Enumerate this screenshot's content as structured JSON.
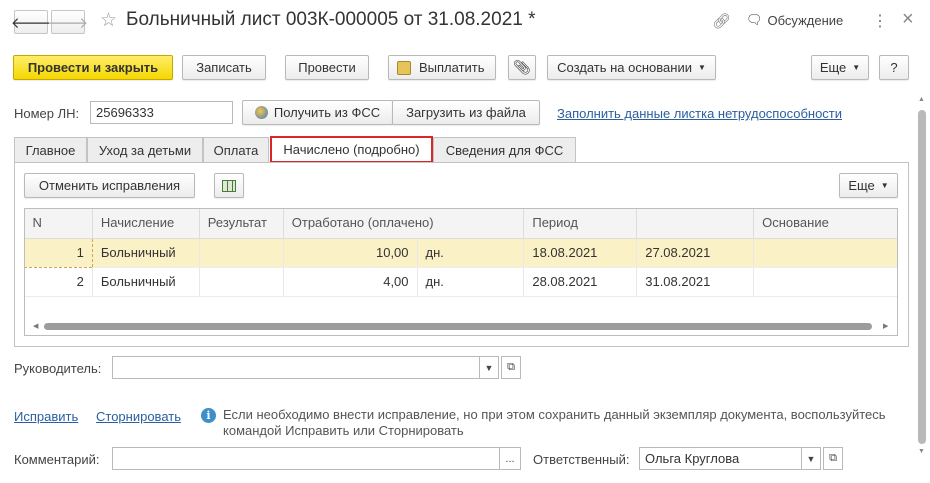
{
  "window": {
    "title": "Больничный лист 003К-000005 от 31.08.2021 *",
    "discussion_label": "Обсуждение",
    "more_dots": "⋮",
    "close": "×"
  },
  "toolbar": {
    "post_close": "Провести и закрыть",
    "write": "Записать",
    "post": "Провести",
    "pay": "Выплатить",
    "create_based": "Создать на основании",
    "more": "Еще",
    "help": "?"
  },
  "header": {
    "ln_label": "Номер ЛН:",
    "ln_value": "25696333",
    "get_fss": "Получить из ФСС",
    "load_file": "Загрузить из файла",
    "fill_link": "Заполнить данные листка нетрудоспособности"
  },
  "tabs": [
    {
      "label": "Главное"
    },
    {
      "label": "Уход за детьми"
    },
    {
      "label": "Оплата"
    },
    {
      "label": "Начислено (подробно)"
    },
    {
      "label": "Сведения для ФСС"
    }
  ],
  "panel": {
    "cancel_fix": "Отменить исправления",
    "more": "Еще"
  },
  "table": {
    "columns": [
      "N",
      "Начисление",
      "Результат",
      "Отработано (оплачено)",
      "",
      "Период",
      "",
      "Основание"
    ],
    "rows": [
      {
        "n": "1",
        "accrual": "Больничный",
        "result": "",
        "worked": "10,00",
        "unit": "дн.",
        "from": "18.08.2021",
        "to": "27.08.2021",
        "basis": ""
      },
      {
        "n": "2",
        "accrual": "Больничный",
        "result": "",
        "worked": "4,00",
        "unit": "дн.",
        "from": "28.08.2021",
        "to": "31.08.2021",
        "basis": ""
      }
    ]
  },
  "footer": {
    "manager_label": "Руководитель:",
    "manager_value": "",
    "fix_link": "Исправить",
    "storno_link": "Сторнировать",
    "info_text": "Если необходимо внести исправление, но при этом сохранить данный экземпляр документа, воспользуйтесь командой Исправить или Сторнировать",
    "comment_label": "Комментарий:",
    "comment_value": "",
    "responsible_label": "Ответственный:",
    "responsible_value": "Ольга Круглова"
  },
  "colors": {
    "primary_button": "#f5d800",
    "link": "#2a5fa0",
    "active_tab_border": "#d9262a",
    "selected_row": "#fbf1c6"
  }
}
